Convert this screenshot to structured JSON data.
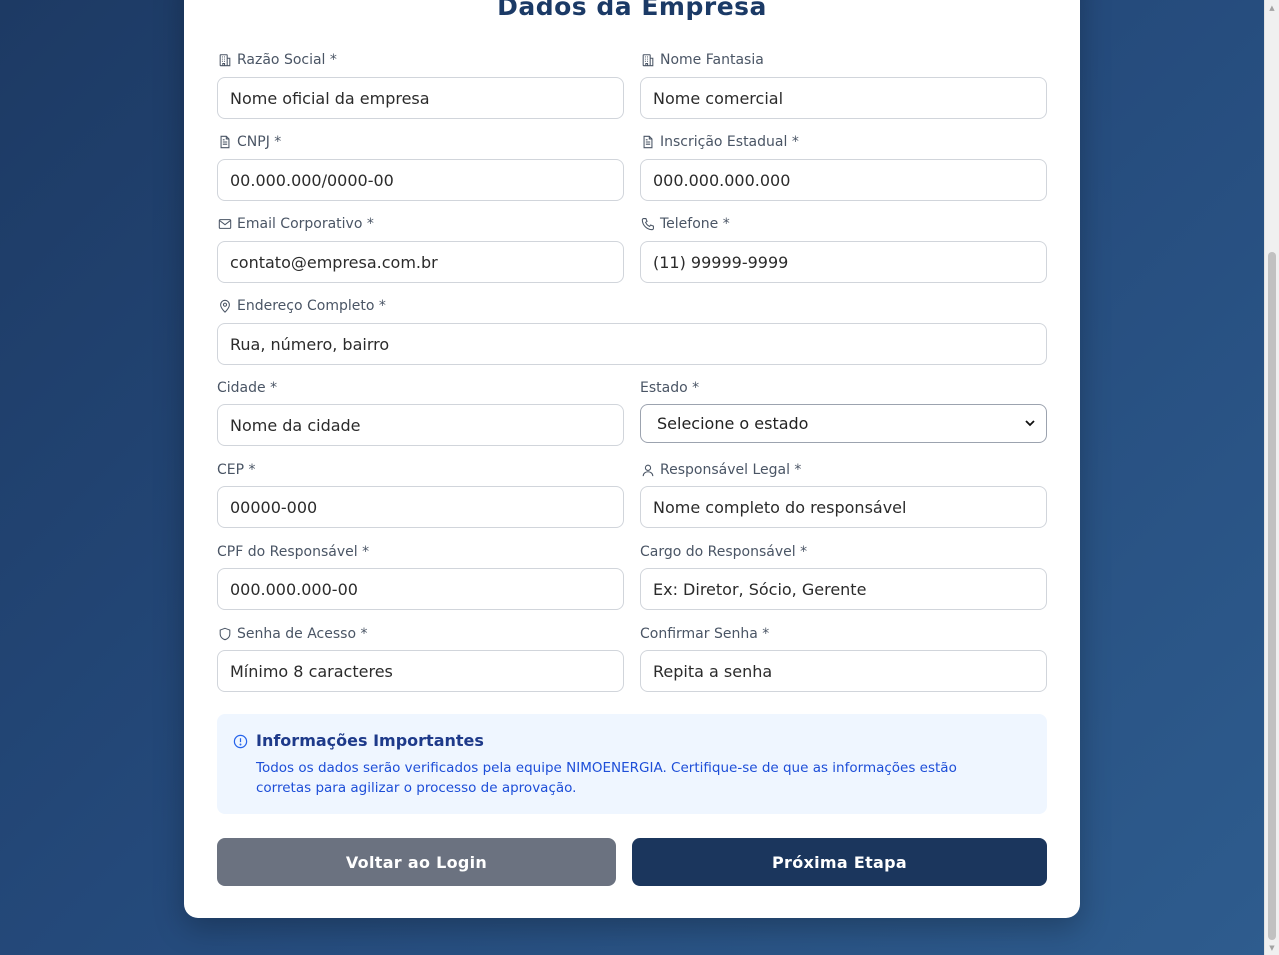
{
  "form": {
    "title": "Dados da Empresa",
    "fields": {
      "razao_social": {
        "label": "Razão Social *",
        "placeholder": "Nome oficial da empresa"
      },
      "nome_fantasia": {
        "label": "Nome Fantasia",
        "placeholder": "Nome comercial"
      },
      "cnpj": {
        "label": "CNPJ *",
        "placeholder": "00.000.000/0000-00"
      },
      "inscricao_estadual": {
        "label": "Inscrição Estadual *",
        "placeholder": "000.000.000.000"
      },
      "email": {
        "label": "Email Corporativo *",
        "placeholder": "contato@empresa.com.br"
      },
      "telefone": {
        "label": "Telefone *",
        "placeholder": "(11) 99999-9999"
      },
      "endereco": {
        "label": "Endereço Completo *",
        "placeholder": "Rua, número, bairro"
      },
      "cidade": {
        "label": "Cidade *",
        "placeholder": "Nome da cidade"
      },
      "estado": {
        "label": "Estado *",
        "selected": "Selecione o estado"
      },
      "cep": {
        "label": "CEP *",
        "placeholder": "00000-000"
      },
      "responsavel": {
        "label": "Responsável Legal *",
        "placeholder": "Nome completo do responsável"
      },
      "cpf": {
        "label": "CPF do Responsável *",
        "placeholder": "000.000.000-00"
      },
      "cargo": {
        "label": "Cargo do Responsável *",
        "placeholder": "Ex: Diretor, Sócio, Gerente"
      },
      "senha": {
        "label": "Senha de Acesso *",
        "placeholder": "Mínimo 8 caracteres"
      },
      "confirmar_senha": {
        "label": "Confirmar Senha *",
        "placeholder": "Repita a senha"
      }
    },
    "info": {
      "title": "Informações Importantes",
      "text": "Todos os dados serão verificados pela equipe NIMOENERGIA. Certifique-se de que as informações estão corretas para agilizar o processo de aprovação."
    },
    "buttons": {
      "back": "Voltar ao Login",
      "next": "Próxima Etapa"
    }
  },
  "colors": {
    "title": "#1b3a66",
    "primary_button": "#1b365d",
    "secondary_button": "#6b7280",
    "info_bg": "#eff6ff",
    "info_text": "#1d4ed8"
  },
  "icons": {
    "razao_social": "building-icon",
    "nome_fantasia": "building-icon",
    "cnpj": "document-icon",
    "inscricao_estadual": "document-icon",
    "email": "mail-icon",
    "telefone": "phone-icon",
    "endereco": "map-pin-icon",
    "responsavel": "user-icon",
    "senha": "shield-icon",
    "info": "info-icon"
  }
}
